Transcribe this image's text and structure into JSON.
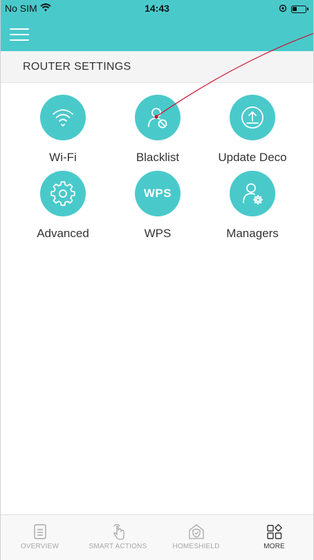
{
  "status_bar": {
    "carrier": "No SIM",
    "time": "14:43",
    "battery_level": 0.35
  },
  "app_bar": {
    "menu_icon": "hamburger-menu-icon"
  },
  "section": {
    "title": "ROUTER SETTINGS"
  },
  "tiles": [
    {
      "label": "Wi-Fi",
      "icon": "wifi-icon"
    },
    {
      "label": "Blacklist",
      "icon": "user-blocked-icon"
    },
    {
      "label": "Update Deco",
      "icon": "firmware-upload-icon"
    },
    {
      "label": "Advanced",
      "icon": "gear-icon"
    },
    {
      "label": "WPS",
      "icon": "wps-icon",
      "icon_text": "WPS"
    },
    {
      "label": "Managers",
      "icon": "user-gear-icon"
    }
  ],
  "tab_bar": {
    "tabs": [
      {
        "label": "OVERVIEW",
        "icon": "document-icon",
        "active": false
      },
      {
        "label": "SMART ACTIONS",
        "icon": "tap-hand-icon",
        "active": false
      },
      {
        "label": "HOMESHIELD",
        "icon": "home-shield-icon",
        "active": false
      },
      {
        "label": "MORE",
        "icon": "more-grid-icon",
        "active": true
      }
    ]
  },
  "colors": {
    "accent": "#4ac9cb",
    "annotation_arrow": "#c8102e",
    "inactive_tab": "#a7a7a7",
    "active_tab": "#333333"
  }
}
